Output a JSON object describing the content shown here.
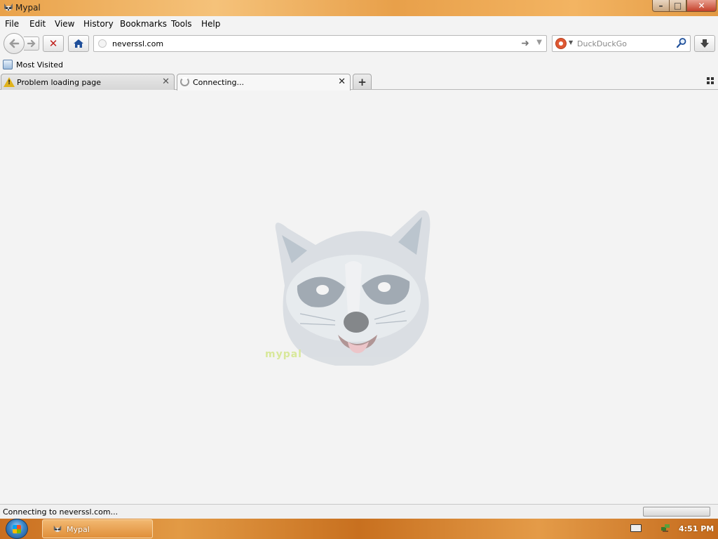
{
  "window": {
    "title": "Mypal",
    "buttons": {
      "minimize": "–",
      "maximize": "□",
      "close": "✕"
    }
  },
  "menu": [
    "File",
    "Edit",
    "View",
    "History",
    "Bookmarks",
    "Tools",
    "Help"
  ],
  "navbar": {
    "url": "neverssl.com",
    "search_placeholder": "DuckDuckGo",
    "stop_glyph": "✕"
  },
  "bookmarks": {
    "items": [
      {
        "label": "Most Visited"
      }
    ]
  },
  "tabs": [
    {
      "label": "Problem loading page",
      "state": "error"
    },
    {
      "label": "Connecting...",
      "state": "loading",
      "active": true
    }
  ],
  "newtab_glyph": "+",
  "status": {
    "text": "Connecting to neverssl.com..."
  },
  "taskbar": {
    "items": [
      {
        "label": "Mypal"
      }
    ],
    "clock": "4:51 PM"
  },
  "colors": {
    "accent": "#e8a04a",
    "stop": "#c0201c",
    "home": "#1f4f9a"
  }
}
